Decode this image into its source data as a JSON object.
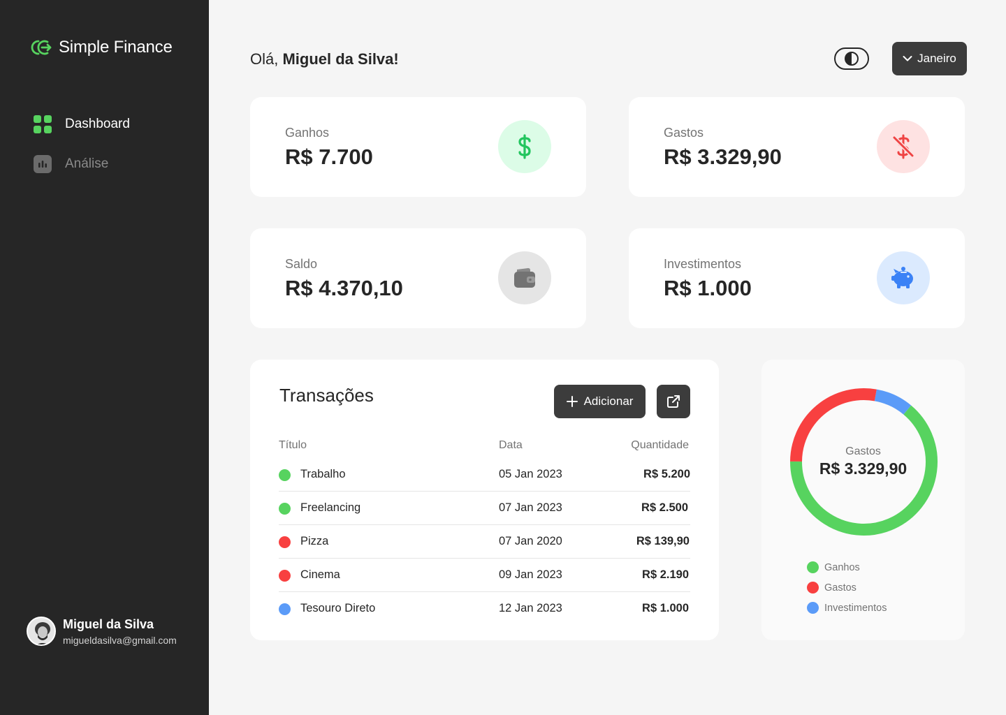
{
  "app": {
    "name": "Simple Finance"
  },
  "nav": {
    "dashboard": "Dashboard",
    "analise": "Análise"
  },
  "user": {
    "name": "Miguel da Silva",
    "email": "migueldasilva@gmail.com"
  },
  "header": {
    "greeting_prefix": "Olá, ",
    "greeting_name": "Miguel da Silva!",
    "month": "Janeiro"
  },
  "cards": {
    "ganhos": {
      "label": "Ganhos",
      "value": "R$ 7.700",
      "icon": "dollar-icon",
      "color": "#22c55e",
      "bg": "#dcfce7"
    },
    "gastos": {
      "label": "Gastos",
      "value": "R$ 3.329,90",
      "icon": "dollar-off-icon",
      "color": "#ef4444",
      "bg": "#fee2e2"
    },
    "saldo": {
      "label": "Saldo",
      "value": "R$ 4.370,10",
      "icon": "wallet-icon",
      "color": "#737373",
      "bg": "#e5e5e5"
    },
    "investimentos": {
      "label": "Investimentos",
      "value": "R$ 1.000",
      "icon": "piggy-bank-icon",
      "color": "#3b82f6",
      "bg": "#dbeafe"
    }
  },
  "transactions": {
    "title": "Transações",
    "add_label": "Adicionar",
    "columns": {
      "title": "Título",
      "date": "Data",
      "amount": "Quantidade"
    },
    "rows": [
      {
        "name": "Trabalho",
        "date": "05 Jan 2023",
        "amount": "R$ 5.200",
        "type": "ganho",
        "color": "#57d35f"
      },
      {
        "name": "Freelancing",
        "date": "07 Jan 2023",
        "amount": "R$ 2.500",
        "type": "ganho",
        "color": "#57d35f"
      },
      {
        "name": "Pizza",
        "date": "07 Jan 2020",
        "amount": "R$ 139,90",
        "type": "gasto",
        "color": "#f84040"
      },
      {
        "name": "Cinema",
        "date": "09 Jan 2023",
        "amount": "R$ 2.190",
        "type": "gasto",
        "color": "#f84040"
      },
      {
        "name": "Tesouro Direto",
        "date": "12 Jan 2023",
        "amount": "R$ 1.000",
        "type": "investimento",
        "color": "#5b9bf8"
      }
    ]
  },
  "chart": {
    "center_label": "Gastos",
    "center_value": "R$ 3.329,90",
    "legend": [
      {
        "name": "Ganhos",
        "color": "#57d35f"
      },
      {
        "name": "Gastos",
        "color": "#f84040"
      },
      {
        "name": "Investimentos",
        "color": "#5b9bf8"
      }
    ]
  },
  "chart_data": {
    "type": "pie",
    "categories": [
      "Ganhos",
      "Gastos",
      "Investimentos"
    ],
    "values": [
      7700,
      3329.9,
      1000
    ],
    "colors": [
      "#57d35f",
      "#f84040",
      "#5b9bf8"
    ],
    "title": "Gastos",
    "donut": true
  }
}
